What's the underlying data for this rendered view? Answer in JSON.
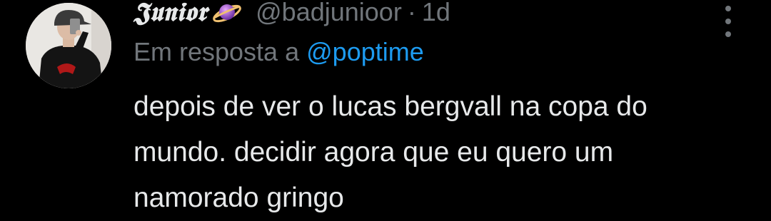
{
  "tweet": {
    "display_name": "𝕵𝖚𝖓𝖎𝖔𝖗",
    "name_emoji": "planet-icon",
    "handle": "@badjunioor",
    "separator": "·",
    "time": "1d",
    "reply_prefix": "Em resposta a",
    "reply_mention": "@poptime",
    "text_lines": [
      "depois de ver o lucas bergvall na copa do",
      "mundo. decidir agora que eu quero um",
      "namorado gringo"
    ]
  },
  "colors": {
    "background": "#000000",
    "text_primary": "#e7e9ea",
    "text_secondary": "#71767b",
    "link": "#1d9bf0"
  }
}
